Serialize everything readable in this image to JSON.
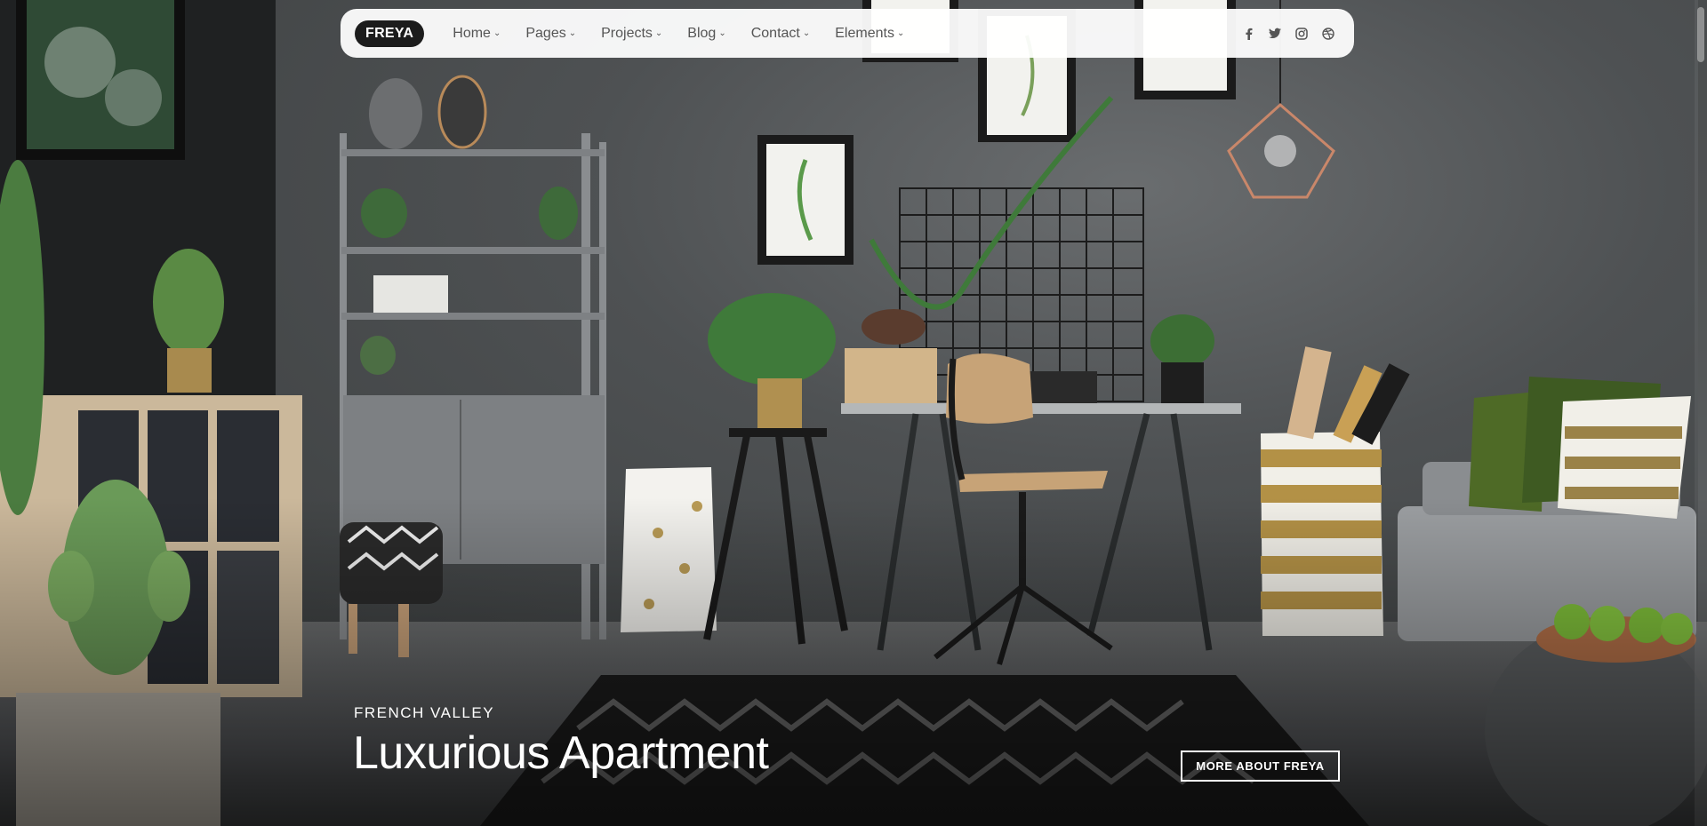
{
  "brand": {
    "logo_text": "FREYA"
  },
  "nav": {
    "items": [
      {
        "label": "Home",
        "caret": "⌄"
      },
      {
        "label": "Pages",
        "caret": "⌄"
      },
      {
        "label": "Projects",
        "caret": "⌄"
      },
      {
        "label": "Blog",
        "caret": "⌄"
      },
      {
        "label": "Contact",
        "caret": "⌄"
      },
      {
        "label": "Elements",
        "caret": "⌄"
      }
    ],
    "social_icons": [
      "facebook-icon",
      "twitter-icon",
      "instagram-icon",
      "dribbble-icon"
    ]
  },
  "hero": {
    "kicker": "FRENCH VALLEY",
    "title": "Luxurious Apartment",
    "cta_label": "MORE ABOUT FREYA"
  },
  "colors": {
    "nav_bg": "#ffffff",
    "brand_pill": "#1c1c1c",
    "nav_text": "#555555",
    "hero_text": "#ffffff"
  }
}
